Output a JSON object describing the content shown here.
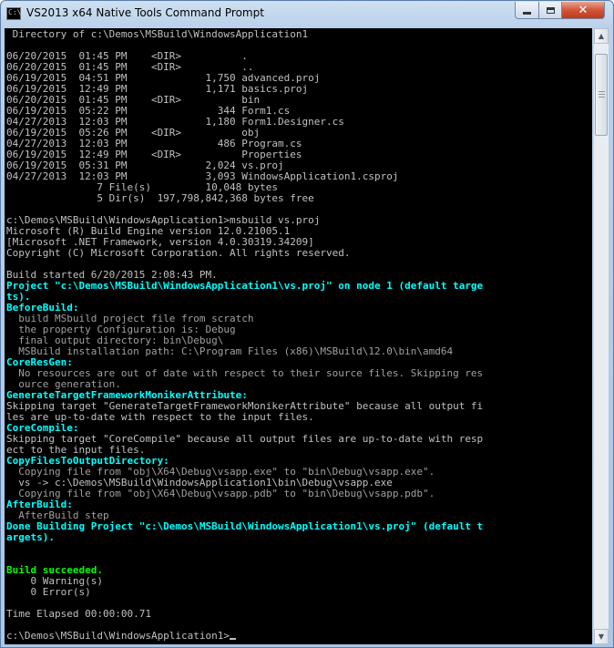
{
  "window": {
    "title": "VS2013 x64 Native Tools Command Prompt",
    "icon_text": "C:\\",
    "controls": {
      "minimize": "minimize",
      "maximize": "maximize",
      "close": "✕"
    }
  },
  "console": {
    "lines": [
      {
        "text": " Directory of c:\\Demos\\MSBuild\\WindowsApplication1",
        "color": "gray"
      },
      {
        "text": "",
        "color": "gray"
      },
      {
        "text": "06/20/2015  01:45 PM    <DIR>          .",
        "color": "gray"
      },
      {
        "text": "06/20/2015  01:45 PM    <DIR>          ..",
        "color": "gray"
      },
      {
        "text": "06/19/2015  04:51 PM             1,750 advanced.proj",
        "color": "gray"
      },
      {
        "text": "06/19/2015  12:49 PM             1,171 basics.proj",
        "color": "gray"
      },
      {
        "text": "06/20/2015  01:45 PM    <DIR>          bin",
        "color": "gray"
      },
      {
        "text": "06/19/2015  05:22 PM               344 Form1.cs",
        "color": "gray"
      },
      {
        "text": "04/27/2013  12:03 PM             1,180 Form1.Designer.cs",
        "color": "gray"
      },
      {
        "text": "06/19/2015  05:26 PM    <DIR>          obj",
        "color": "gray"
      },
      {
        "text": "04/27/2013  12:03 PM               486 Program.cs",
        "color": "gray"
      },
      {
        "text": "06/19/2015  12:49 PM    <DIR>          Properties",
        "color": "gray"
      },
      {
        "text": "06/19/2015  05:31 PM             2,024 vs.proj",
        "color": "gray"
      },
      {
        "text": "04/27/2013  12:03 PM             3,093 WindowsApplication1.csproj",
        "color": "gray"
      },
      {
        "text": "               7 File(s)         10,048 bytes",
        "color": "gray"
      },
      {
        "text": "               5 Dir(s)  197,798,842,368 bytes free",
        "color": "gray"
      },
      {
        "text": "",
        "color": "gray"
      },
      {
        "text": "c:\\Demos\\MSBuild\\WindowsApplication1>msbuild vs.proj",
        "color": "gray"
      },
      {
        "text": "Microsoft (R) Build Engine version 12.0.21005.1",
        "color": "gray"
      },
      {
        "text": "[Microsoft .NET Framework, version 4.0.30319.34209]",
        "color": "gray"
      },
      {
        "text": "Copyright (C) Microsoft Corporation. All rights reserved.",
        "color": "gray"
      },
      {
        "text": "",
        "color": "gray"
      },
      {
        "text": "Build started 6/20/2015 2:08:43 PM.",
        "color": "gray"
      },
      {
        "text": "Project \"c:\\Demos\\MSBuild\\WindowsApplication1\\vs.proj\" on node 1 (default targe",
        "color": "cyan"
      },
      {
        "text": "ts).",
        "color": "cyan"
      },
      {
        "text": "BeforeBuild:",
        "color": "cyan"
      },
      {
        "text": "  build MSbuild project file from scratch",
        "color": "dim"
      },
      {
        "text": "  the property Configuration is: Debug",
        "color": "dim"
      },
      {
        "text": "  final output directory: bin\\Debug\\",
        "color": "dim"
      },
      {
        "text": "  MSBuild installation path: C:\\Program Files (x86)\\MSBuild\\12.0\\bin\\amd64",
        "color": "dim"
      },
      {
        "text": "CoreResGen:",
        "color": "cyan"
      },
      {
        "text": "  No resources are out of date with respect to their source files. Skipping res",
        "color": "dim"
      },
      {
        "text": "  ource generation.",
        "color": "dim"
      },
      {
        "text": "GenerateTargetFrameworkMonikerAttribute:",
        "color": "cyan"
      },
      {
        "text": "Skipping target \"GenerateTargetFrameworkMonikerAttribute\" because all output fi",
        "color": "gray"
      },
      {
        "text": "les are up-to-date with respect to the input files.",
        "color": "gray"
      },
      {
        "text": "CoreCompile:",
        "color": "cyan"
      },
      {
        "text": "Skipping target \"CoreCompile\" because all output files are up-to-date with resp",
        "color": "gray"
      },
      {
        "text": "ect to the input files.",
        "color": "gray"
      },
      {
        "text": "CopyFilesToOutputDirectory:",
        "color": "cyan"
      },
      {
        "text": "  Copying file from \"obj\\X64\\Debug\\vsapp.exe\" to \"bin\\Debug\\vsapp.exe\".",
        "color": "dim"
      },
      {
        "text": "  vs -> c:\\Demos\\MSBuild\\WindowsApplication1\\bin\\Debug\\vsapp.exe",
        "color": "gray"
      },
      {
        "text": "  Copying file from \"obj\\X64\\Debug\\vsapp.pdb\" to \"bin\\Debug\\vsapp.pdb\".",
        "color": "dim"
      },
      {
        "text": "AfterBuild:",
        "color": "cyan"
      },
      {
        "text": "  AfterBuild step",
        "color": "dim"
      },
      {
        "text": "Done Building Project \"c:\\Demos\\MSBuild\\WindowsApplication1\\vs.proj\" (default t",
        "color": "cyan"
      },
      {
        "text": "argets).",
        "color": "cyan"
      },
      {
        "text": "",
        "color": "gray"
      },
      {
        "text": "",
        "color": "gray"
      },
      {
        "text": "Build succeeded.",
        "color": "green"
      },
      {
        "text": "    0 Warning(s)",
        "color": "gray"
      },
      {
        "text": "    0 Error(s)",
        "color": "gray"
      },
      {
        "text": "",
        "color": "gray"
      },
      {
        "text": "Time Elapsed 00:00:00.71",
        "color": "gray"
      },
      {
        "text": "",
        "color": "gray"
      }
    ],
    "prompt": "c:\\Demos\\MSBuild\\WindowsApplication1>",
    "colors": {
      "gray": "#c0c0c0",
      "cyan": "#00ffff",
      "green": "#00ff00",
      "dim": "#a0a0a0",
      "background": "#000000"
    }
  },
  "scrollbar": {
    "up_icon": "arrow-up-icon",
    "down_icon": "arrow-down-icon"
  }
}
